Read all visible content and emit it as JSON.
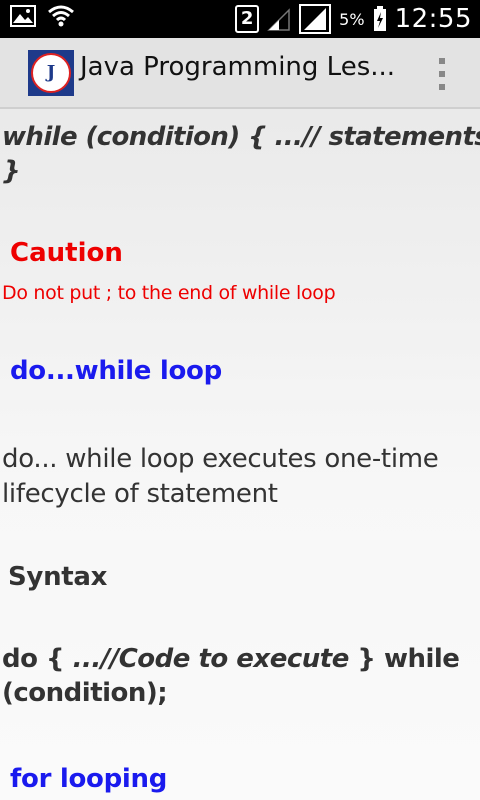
{
  "status_bar": {
    "sim_slot": "2",
    "battery_percent": "5%",
    "time": "12:55",
    "icons": [
      "image-icon",
      "wifi-icon",
      "sim-icon",
      "signal-icon",
      "signal-icon",
      "battery-charging-icon"
    ]
  },
  "action_bar": {
    "logo_letter": "J",
    "title": "Java Programming Les..."
  },
  "content": {
    "code_while_line1": "while (condition) { ...// statements",
    "code_while_line2": "}",
    "caution_title": "Caution",
    "caution_body": "Do not put ; to the end of while loop",
    "dowhile_title": "do...while loop",
    "dowhile_desc_line1": "do... while loop executes one-time",
    "dowhile_desc_line2": "lifecycle of statement",
    "syntax_label": "Syntax",
    "code_do_prefix": "do { ",
    "code_do_comment": "...//Code to execute",
    "code_do_suffix": " } while",
    "code_do_line2": "(condition);",
    "for_title": "for looping"
  },
  "colors": {
    "caution": "#ee0000",
    "heading_blue": "#1a1aee",
    "text": "#333333"
  }
}
